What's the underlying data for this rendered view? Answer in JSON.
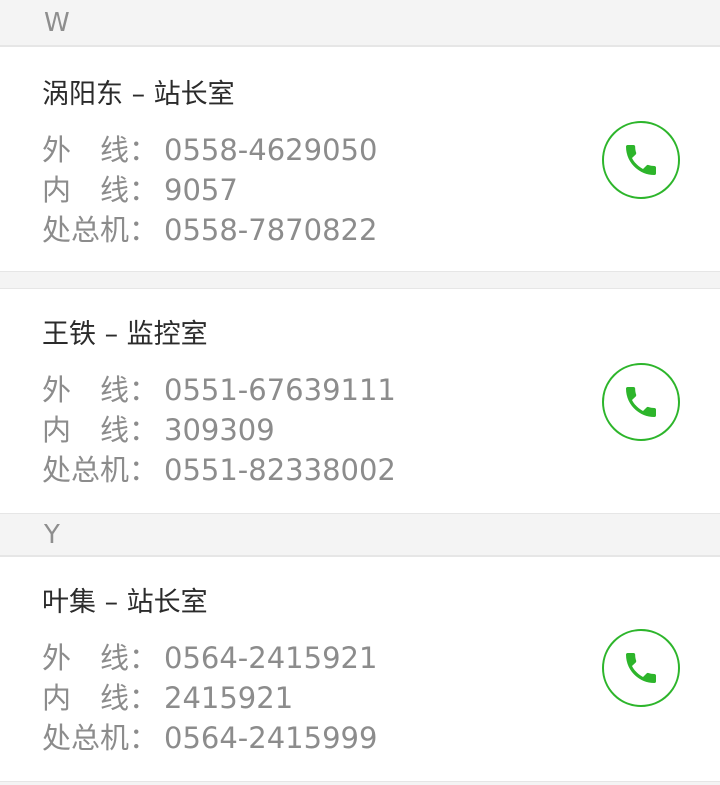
{
  "sections": [
    {
      "letter": "W",
      "contacts": [
        {
          "title": "涡阳东 – 站长室",
          "lines": [
            {
              "label": "外　线：",
              "value": "0558-4629050"
            },
            {
              "label": "内　线：",
              "value": "9057"
            },
            {
              "label": "处总机：",
              "value": "0558-7870822"
            }
          ]
        },
        {
          "title": "王铁 – 监控室",
          "lines": [
            {
              "label": "外　线：",
              "value": "0551-67639111"
            },
            {
              "label": "内　线：",
              "value": "309309"
            },
            {
              "label": "处总机：",
              "value": "0551-82338002"
            }
          ]
        }
      ]
    },
    {
      "letter": "Y",
      "contacts": [
        {
          "title": " 叶集 – 站长室",
          "lines": [
            {
              "label": "外　线：",
              "value": "0564-2415921"
            },
            {
              "label": "内　线：",
              "value": "2415921"
            },
            {
              "label": "处总机：",
              "value": "0564-2415999"
            }
          ]
        }
      ]
    }
  ],
  "icons": {
    "call": "phone-icon"
  },
  "colors": {
    "accent_green": "#2db52b",
    "title_text": "#2b2b2b",
    "detail_text": "#8c8c8c",
    "header_text": "#8e8e8e",
    "background": "#f4f4f4"
  }
}
